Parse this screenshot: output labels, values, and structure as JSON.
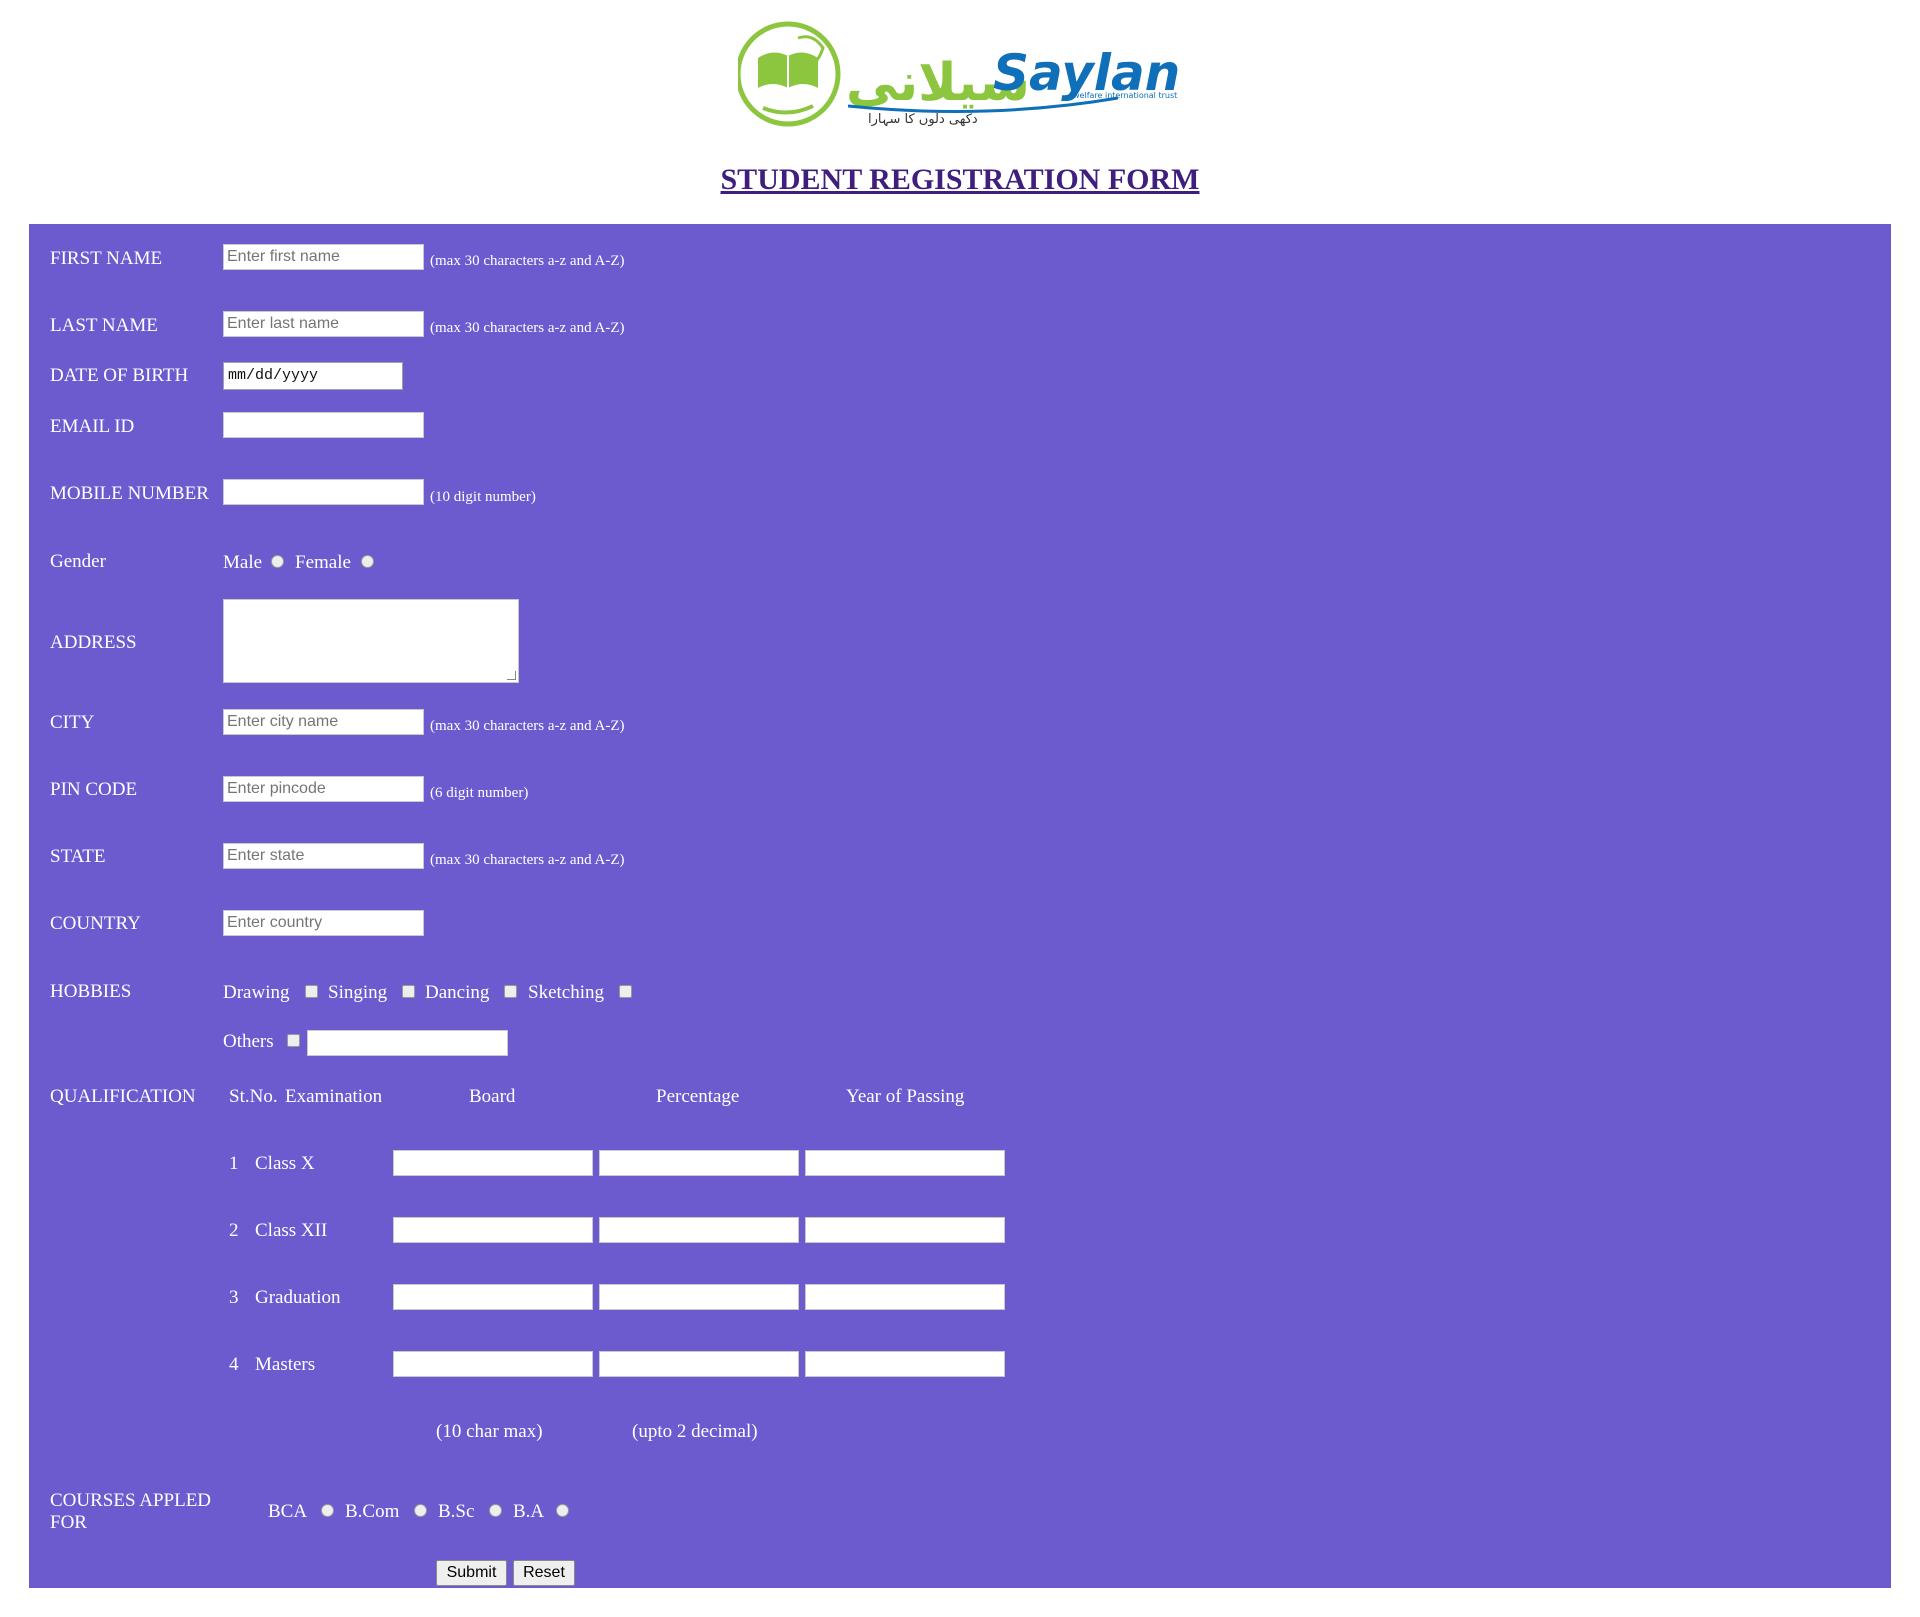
{
  "logo": {
    "brand": "Saylani",
    "urdu": "سیلانی",
    "tagline": "welfare international trust",
    "urdu_tagline": "دکھی دلوں کا سہارا"
  },
  "page_title": "STUDENT REGISTRATION FORM",
  "colors": {
    "panel": "#6c5bcf",
    "title": "#3f1e7e",
    "logo_green": "#8cc63f",
    "logo_blue": "#0f6fb8"
  },
  "fields": {
    "first_name": {
      "label": "FIRST NAME",
      "placeholder": "Enter first name",
      "hint": "(max 30 characters a-z and A-Z)"
    },
    "last_name": {
      "label": "LAST NAME",
      "placeholder": "Enter last name",
      "hint": "(max 30 characters a-z and A-Z)"
    },
    "dob": {
      "label": "DATE OF BIRTH",
      "value": "mm/dd/yyyy"
    },
    "email": {
      "label": "EMAIL ID"
    },
    "mobile": {
      "label": "MOBILE NUMBER",
      "hint": "(10 digit number)"
    },
    "gender": {
      "label": "Gender",
      "options": [
        "Male",
        "Female"
      ]
    },
    "address": {
      "label": "ADDRESS"
    },
    "city": {
      "label": "CITY",
      "placeholder": "Enter city name",
      "hint": "(max 30 characters a-z and A-Z)"
    },
    "pin": {
      "label": "PIN CODE",
      "placeholder": "Enter pincode",
      "hint": "(6 digit number)"
    },
    "state": {
      "label": "STATE",
      "placeholder": "Enter state",
      "hint": "(max 30 characters a-z and A-Z)"
    },
    "country": {
      "label": "COUNTRY",
      "placeholder": "Enter country"
    }
  },
  "hobbies": {
    "label": "HOBBIES",
    "options": [
      "Drawing",
      "Singing",
      "Dancing",
      "Sketching",
      "Others"
    ]
  },
  "qualification": {
    "label": "QUALIFICATION",
    "headers": [
      "St.No.",
      "Examination",
      "Board",
      "Percentage",
      "Year of Passing"
    ],
    "rows": [
      {
        "no": "1",
        "exam": "Class X"
      },
      {
        "no": "2",
        "exam": "Class XII"
      },
      {
        "no": "3",
        "exam": "Graduation"
      },
      {
        "no": "4",
        "exam": "Masters"
      }
    ],
    "board_hint": "(10 char max)",
    "percentage_hint": "(upto 2 decimal)"
  },
  "courses": {
    "label": "COURSES APPLED FOR",
    "options": [
      "BCA",
      "B.Com",
      "B.Sc",
      "B.A"
    ]
  },
  "buttons": {
    "submit": "Submit",
    "reset": "Reset"
  }
}
